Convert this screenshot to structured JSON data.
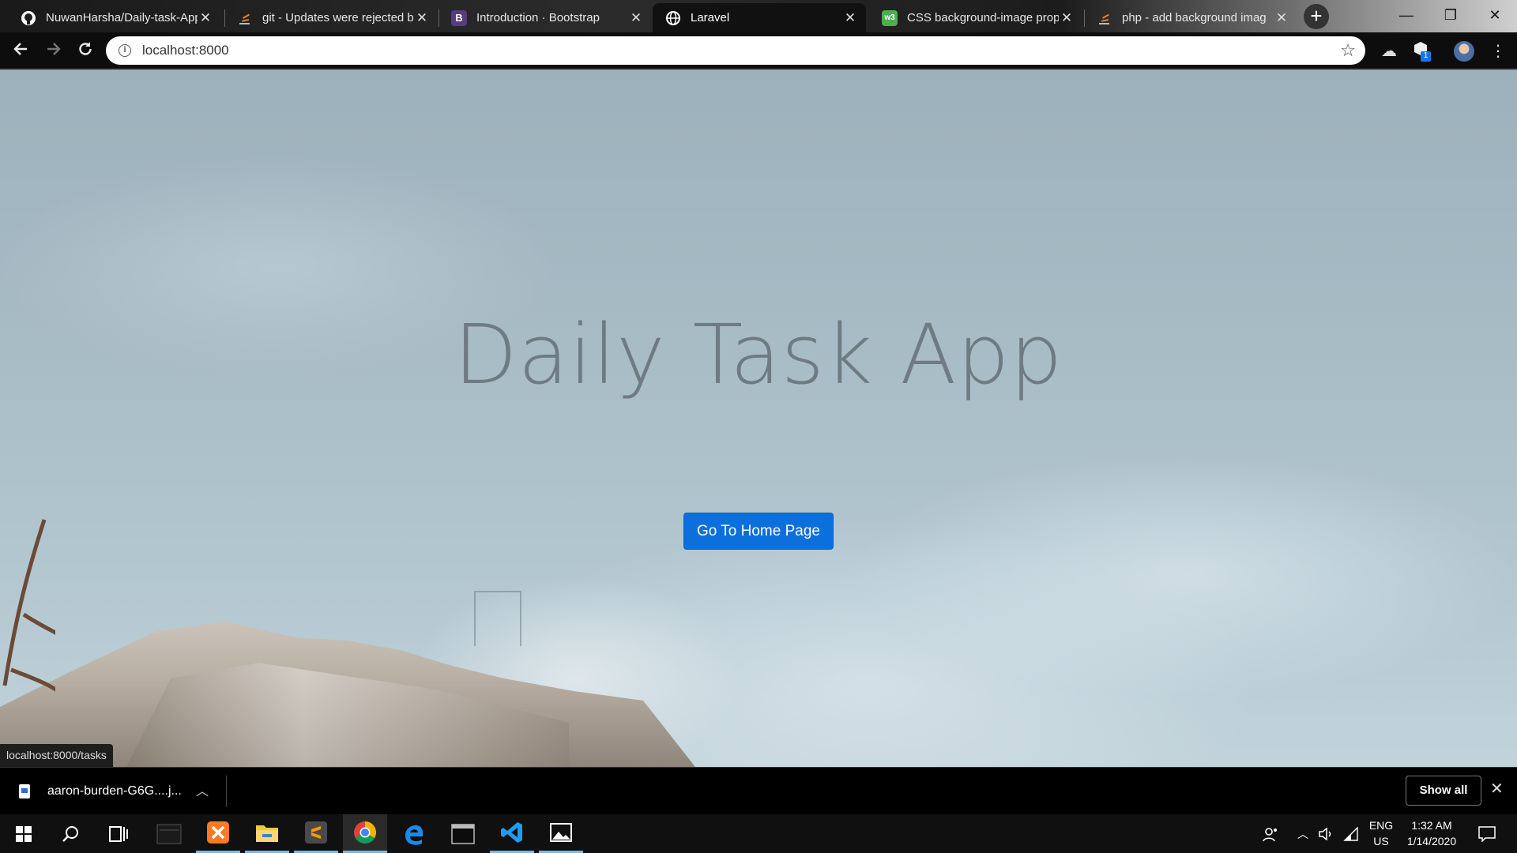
{
  "browser": {
    "tabs": [
      {
        "title": "NuwanHarsha/Daily-task-App",
        "icon": "github-icon"
      },
      {
        "title": "git - Updates were rejected b",
        "icon": "stackoverflow-icon"
      },
      {
        "title": "Introduction · Bootstrap",
        "icon": "bootstrap-icon"
      },
      {
        "title": "Laravel",
        "icon": "globe-icon"
      },
      {
        "title": "CSS background-image prop",
        "icon": "w3schools-icon"
      },
      {
        "title": "php - add background imag",
        "icon": "stackoverflow-icon"
      }
    ],
    "active_tab_index": 3,
    "address": "localhost:8000",
    "extension_badge": "1",
    "colors": {
      "bootstrap": "#563d7c",
      "w3": "#4caf50",
      "stackoverflow": "#f48024"
    }
  },
  "page": {
    "title": "Daily Task App",
    "button_label": "Go To Home Page",
    "button_color": "#0b6fdc",
    "status_url": "localhost:8000/tasks"
  },
  "downloads": {
    "file_name": "aaron-burden-G6G....j...",
    "show_all_label": "Show all"
  },
  "taskbar": {
    "apps": [
      "start-icon",
      "search-icon",
      "task-view-icon",
      "blank-app-icon",
      "xampp-icon",
      "file-explorer-icon",
      "sublime-text-icon",
      "chrome-icon",
      "edge-icon",
      "terminal-icon",
      "vscode-icon",
      "photos-icon"
    ],
    "language_line1": "ENG",
    "language_line2": "US",
    "time": "1:32 AM",
    "date": "1/14/2020"
  }
}
